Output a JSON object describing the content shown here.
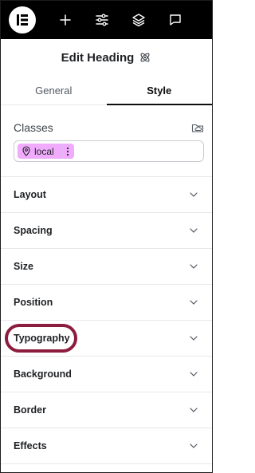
{
  "toolbar": {
    "logo_icon": "elementor-logo-icon",
    "add_icon": "plus-icon",
    "settings_icon": "sliders-icon",
    "structure_icon": "layers-icon",
    "comments_icon": "chat-icon"
  },
  "panel": {
    "title": "Edit Heading",
    "title_icon": "atom-icon"
  },
  "tabs": [
    {
      "label": "General",
      "active": false
    },
    {
      "label": "Style",
      "active": true
    }
  ],
  "classes": {
    "label": "Classes",
    "chip": {
      "label": "local",
      "color": "#f0abfc"
    }
  },
  "sections": [
    {
      "label": "Layout"
    },
    {
      "label": "Spacing"
    },
    {
      "label": "Size"
    },
    {
      "label": "Position"
    },
    {
      "label": "Typography",
      "highlighted": true
    },
    {
      "label": "Background"
    },
    {
      "label": "Border"
    },
    {
      "label": "Effects"
    }
  ],
  "colors": {
    "toolbar_bg": "#000000",
    "highlight": "#8c1d3f",
    "chip_bg": "#f0abfc"
  }
}
